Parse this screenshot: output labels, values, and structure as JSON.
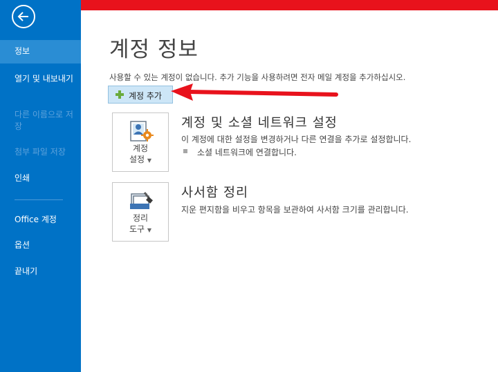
{
  "sidebar": {
    "items": [
      {
        "label": "정보",
        "state": "selected"
      },
      {
        "label": "열기 및 내보내기",
        "state": "normal"
      },
      {
        "label": "다른 이름으로 저장",
        "state": "disabled"
      },
      {
        "label": "첨부 파일 저장",
        "state": "disabled"
      },
      {
        "label": "인쇄",
        "state": "normal"
      },
      {
        "label": "Office 계정",
        "state": "normal"
      },
      {
        "label": "옵션",
        "state": "normal"
      },
      {
        "label": "끝내기",
        "state": "normal"
      }
    ],
    "back_icon": "back-arrow-icon"
  },
  "main": {
    "title": "계정 정보",
    "info_text": "사용할 수 있는 계정이 없습니다. 추가 기능을 사용하려면 전자 메일 계정을 추가하십시오.",
    "add_account_label": "계정 추가",
    "sections": [
      {
        "tile_line1": "계정",
        "tile_line2": "설정",
        "icon": "account-settings-icon",
        "title": "계정 및 소셜 네트워크 설정",
        "desc": "이 계정에 대한 설정을 변경하거나 다른 연결을 추가로 설정합니다.",
        "bullet": "소셜 네트워크에 연결합니다."
      },
      {
        "tile_line1": "정리",
        "tile_line2": "도구",
        "icon": "cleanup-tools-icon",
        "title": "사서함 정리",
        "desc": "지운 편지함을 비우고 항목을 보관하여 사서함 크기를 관리합니다."
      }
    ]
  },
  "colors": {
    "sidebar": "#0072c6",
    "top_bar": "#e8121c",
    "arrow": "#e8121c",
    "selected_item": "#2a8dd4"
  }
}
